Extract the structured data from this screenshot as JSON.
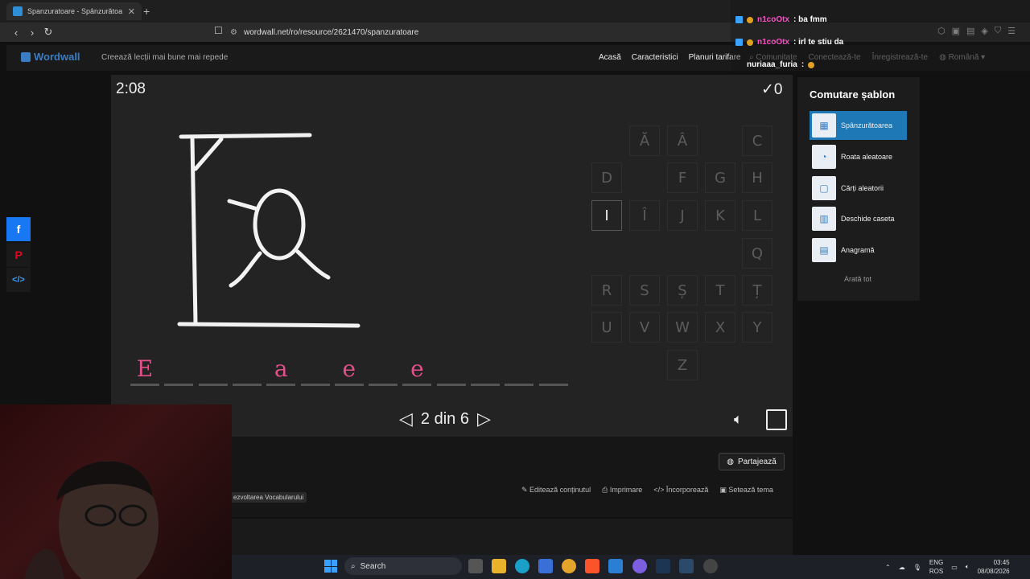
{
  "browser": {
    "tab_title": "Spanzuratoare - Spânzurătoa",
    "url": "wordwall.net/ro/resource/2621470/spanzuratoare"
  },
  "site": {
    "brand": "Wordwall",
    "tagline": "Creează lecții mai bune mai repede",
    "nav": [
      "Acasă",
      "Caracteristici",
      "Planuri tarifare"
    ],
    "nav_secondary": [
      "Comunitate",
      "Conectează-te",
      "Înregistrează-te",
      "Română"
    ]
  },
  "chat": {
    "lines": [
      {
        "user": "n1coOtx",
        "text": ": ba fmm"
      },
      {
        "user": "n1coOtx",
        "text": ": irl te stiu da"
      },
      {
        "user": "nuriaaa_furia",
        "text": ":"
      }
    ]
  },
  "game": {
    "timer": "2:08",
    "score": "0",
    "score_icon": "check-icon",
    "letters": [
      {
        "ch": "Ă",
        "state": "available"
      },
      {
        "ch": "Â",
        "state": "available"
      },
      {
        "ch": "C",
        "state": "available"
      },
      {
        "ch": "D",
        "state": "available"
      },
      {
        "ch": "F",
        "state": "available"
      },
      {
        "ch": "G",
        "state": "available"
      },
      {
        "ch": "H",
        "state": "available"
      },
      {
        "ch": "I",
        "state": "hover"
      },
      {
        "ch": "Î",
        "state": "available"
      },
      {
        "ch": "J",
        "state": "available"
      },
      {
        "ch": "K",
        "state": "available"
      },
      {
        "ch": "L",
        "state": "available"
      },
      {
        "ch": "Q",
        "state": "available"
      },
      {
        "ch": "R",
        "state": "available"
      },
      {
        "ch": "S",
        "state": "available"
      },
      {
        "ch": "Ș",
        "state": "available"
      },
      {
        "ch": "T",
        "state": "available"
      },
      {
        "ch": "Ț",
        "state": "available"
      },
      {
        "ch": "U",
        "state": "available"
      },
      {
        "ch": "V",
        "state": "available"
      },
      {
        "ch": "W",
        "state": "available"
      },
      {
        "ch": "X",
        "state": "available"
      },
      {
        "ch": "Y",
        "state": "available"
      },
      {
        "ch": "Z",
        "state": "available"
      }
    ],
    "word_slots": [
      "E",
      "",
      "",
      "",
      "a",
      "",
      "e",
      "",
      "e",
      "",
      "",
      "",
      ""
    ],
    "pager": "2 din 6"
  },
  "sidebar": {
    "title": "Comutare șablon",
    "templates": [
      {
        "label": "Spânzurătoarea",
        "selected": true
      },
      {
        "label": "Roata aleatoare",
        "selected": false
      },
      {
        "label": "Cărți aleatorii",
        "selected": false
      },
      {
        "label": "Deschide caseta",
        "selected": false
      },
      {
        "label": "Anagramă",
        "selected": false
      }
    ],
    "show_all": "Arată tot"
  },
  "toolbar": {
    "share": "Partajează",
    "actions": [
      "Editează conținutul",
      "Imprimare",
      "Încorporează",
      "Setează tema"
    ],
    "tag": "ezvoltarea Vocabularului"
  },
  "taskbar": {
    "search": "Search",
    "lang_top": "ENG",
    "lang_bottom": "ROS",
    "time": "03:45",
    "date": "08/08/2026"
  }
}
